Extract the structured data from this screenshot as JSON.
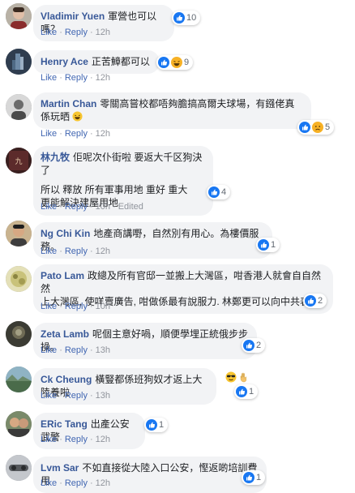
{
  "labels": {
    "like": "Like",
    "reply": "Reply",
    "sep": "·"
  },
  "comments": [
    {
      "name": "Vladimir Yuen",
      "text": "軍營也可以嗎？",
      "time": "12h",
      "reactions": {
        "count": "10",
        "icons": [
          "like-icon",
          "haha-icon"
        ]
      },
      "avatar_color": "#9b3b3b"
    },
    {
      "name": "Henry Ace",
      "text": "正苦鱆都可以",
      "time": "12h",
      "reactions": {
        "count": "9",
        "icons": [
          "like-icon",
          "haha-icon"
        ]
      },
      "avatar_color": "#2f3d4f"
    },
    {
      "name": "Martin Chan",
      "text": "零關高嘗校都唔夠膽搞高爾夫球場，有鏹佬真係玩晒",
      "time": "12h",
      "reactions": {
        "count": "5",
        "icons": [
          "like-icon",
          "sad-icon"
        ]
      },
      "avatar_color": "#6d6f73"
    },
    {
      "name": "林九牧",
      "text_line1": "佢呢次仆街啦 要返大千区狗決了",
      "text_line2": "所以 釋放 所有軍事用地 重好 重大",
      "text_line3": "更能解決建屋用地",
      "time": "10h",
      "edited": "Edited",
      "reactions": {
        "count": "4",
        "icons": [
          "like-icon"
        ]
      },
      "avatar_color": "#3a1f1f"
    },
    {
      "name": "Ng Chi Kin",
      "text": "地產商講嘢，自然別有用心。為樓價服務。",
      "time": "12h",
      "reactions": {
        "count": "1",
        "icons": [
          "like-icon"
        ]
      },
      "avatar_color": "#7a5a3b"
    },
    {
      "name": "Pato Lam",
      "text_line1": "政總及所有官邸一並搬上大灣區，咁香港人就會自自然然",
      "text_line2": "上大灣區, 使咩賣廣告, 咁做係最有說服力. 林鄭更可以向中共表忠.",
      "time": "10h",
      "reactions": {
        "count": "2",
        "icons": [
          "like-icon"
        ]
      },
      "avatar_color": "#c9c27a"
    },
    {
      "name": "Zeta Lamb",
      "text": "呢個主意好喎，順便學埋正統俄步步操。",
      "time": "13h",
      "reactions": {
        "count": "2",
        "icons": [
          "like-icon"
        ]
      },
      "avatar_color": "#3b3b33"
    },
    {
      "name": "Ck Cheung",
      "text": "橫豎都係班狗奴才返上大陸養啦",
      "time": "13h",
      "reactions": {
        "count": "1",
        "icons": [
          "like-icon"
        ]
      },
      "avatar_color": "#4a6b7a"
    },
    {
      "name": "ERic Tang",
      "text": "出產公安武警",
      "time": "12h",
      "reactions": {
        "count": "1",
        "icons": [
          "like-icon"
        ]
      },
      "avatar_color": "#5b4a3c"
    },
    {
      "name": "Lvm Sar",
      "text": "不如直接從大陸入口公安，慳返啲培訓費用",
      "time": "12h",
      "reactions": {
        "count": "1",
        "icons": [
          "like-icon"
        ]
      },
      "avatar_color": "#55585c"
    }
  ],
  "colors": {
    "link": "#385898",
    "action_link": "#4267b2",
    "like_blue": "#1877f2",
    "haha_yellow": "#f7b125",
    "bubble_bg": "#f2f3f5"
  }
}
